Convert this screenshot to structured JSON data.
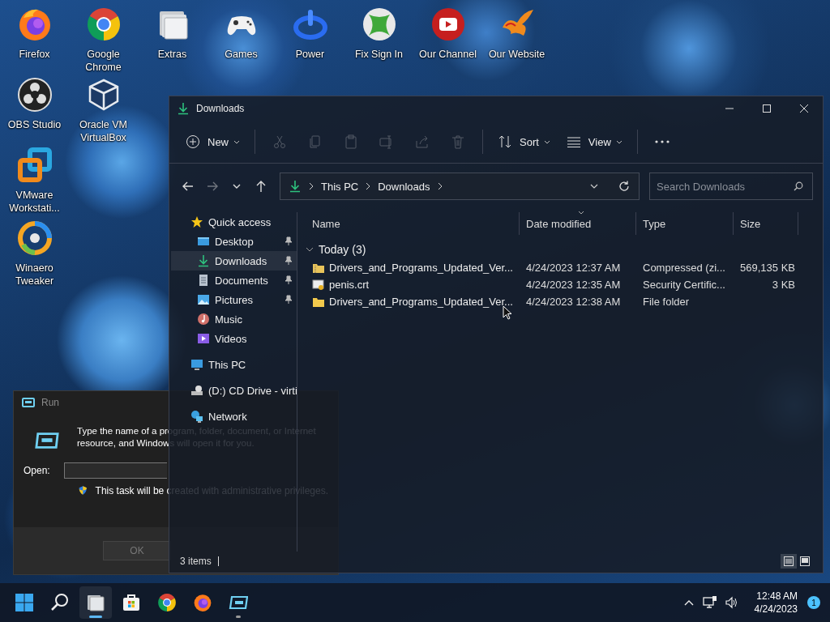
{
  "desktop": {
    "shortcuts": [
      {
        "label": "Firefox",
        "kind": "firefox"
      },
      {
        "label": "Google Chrome",
        "kind": "chrome"
      },
      {
        "label": "Extras",
        "kind": "folders"
      },
      {
        "label": "Games",
        "kind": "gamepad"
      },
      {
        "label": "Power",
        "kind": "power"
      },
      {
        "label": "Fix Sign In",
        "kind": "xball"
      },
      {
        "label": "Our Channel",
        "kind": "play"
      },
      {
        "label": "Our Website",
        "kind": "bird"
      },
      {
        "label": "OBS Studio",
        "kind": "blades"
      },
      {
        "label": "Oracle VM VirtualBox",
        "kind": "cube"
      },
      {
        "label": "VMware Workstati...",
        "kind": "squares"
      },
      {
        "label": "Winaero Tweaker",
        "kind": "swirl"
      }
    ]
  },
  "run_dialog": {
    "title": "Run",
    "message": "Type the name of a program, folder, document, or Internet resource, and Windows will open it for you.",
    "open_label": "Open:",
    "note": "This task will be created with administrative privileges.",
    "buttons": [
      {
        "label": "OK",
        "disabled": true
      }
    ]
  },
  "explorer": {
    "title": "Downloads",
    "toolbar": {
      "new": "New",
      "actions": [
        {
          "kind": "cut",
          "disabled": true
        },
        {
          "kind": "copy",
          "disabled": true
        },
        {
          "kind": "paste",
          "disabled": true
        },
        {
          "kind": "rename",
          "disabled": true
        },
        {
          "kind": "share",
          "disabled": true
        },
        {
          "kind": "delete",
          "disabled": true
        }
      ],
      "sort": "Sort",
      "view": "View"
    },
    "nav": [
      {
        "kind": "back",
        "disabled": false
      },
      {
        "kind": "forward",
        "disabled": true
      },
      {
        "kind": "recent",
        "disabled": false
      },
      {
        "kind": "up",
        "disabled": false
      }
    ],
    "breadcrumbs": [
      "This PC",
      "Downloads"
    ],
    "search": {
      "placeholder": "Search Downloads"
    },
    "sidebar": [
      {
        "label": "Quick access",
        "kind": "star",
        "selected": false,
        "children": [
          {
            "label": "Desktop",
            "kind": "desktop",
            "pinned": true,
            "selected": false
          },
          {
            "label": "Downloads",
            "kind": "download",
            "pinned": true,
            "selected": true
          },
          {
            "label": "Documents",
            "kind": "document",
            "pinned": true,
            "selected": false
          },
          {
            "label": "Pictures",
            "kind": "pictures",
            "pinned": true,
            "selected": false
          },
          {
            "label": "Music",
            "kind": "music",
            "pinned": false,
            "selected": false
          },
          {
            "label": "Videos",
            "kind": "videos",
            "pinned": false,
            "selected": false
          }
        ]
      },
      {
        "label": "This PC",
        "kind": "pc",
        "selected": false
      },
      {
        "label": "(D:) CD Drive - virti",
        "kind": "drive",
        "selected": false
      },
      {
        "label": "Network",
        "kind": "network",
        "selected": false
      }
    ],
    "columns": [
      {
        "label": "Name",
        "sorted": false
      },
      {
        "label": "Date modified",
        "sorted": true
      },
      {
        "label": "Type",
        "sorted": false
      },
      {
        "label": "Size",
        "sorted": false
      }
    ],
    "groups": [
      {
        "label": "Today (3)",
        "expanded": true,
        "rows": [
          {
            "name": "Drivers_and_Programs_Updated_Ver...",
            "kind": "zip",
            "date": "4/24/2023 12:37 AM",
            "type": "Compressed (zi...",
            "size": "569,135 KB"
          },
          {
            "name": "penis.crt",
            "kind": "cert",
            "date": "4/24/2023 12:35 AM",
            "type": "Security Certific...",
            "size": "3 KB"
          },
          {
            "name": "Drivers_and_Programs_Updated_Ver...",
            "kind": "folder",
            "date": "4/24/2023 12:38 AM",
            "type": "File folder"
          }
        ]
      }
    ],
    "status": "3 items",
    "views": [
      {
        "kind": "details",
        "selected": true
      },
      {
        "kind": "tiles",
        "selected": false
      }
    ]
  },
  "taskbar": {
    "apps": [
      {
        "kind": "start",
        "active": false,
        "running": false
      },
      {
        "kind": "search",
        "active": false,
        "running": false
      },
      {
        "kind": "explorer",
        "active": true,
        "running": true
      },
      {
        "kind": "store",
        "active": false,
        "running": false
      },
      {
        "kind": "chrome",
        "active": false,
        "running": false
      },
      {
        "kind": "firefox",
        "active": false,
        "running": false
      },
      {
        "kind": "run",
        "active": false,
        "running": true
      }
    ],
    "time": "12:48 AM",
    "date": "4/24/2023",
    "notifications": "1"
  }
}
